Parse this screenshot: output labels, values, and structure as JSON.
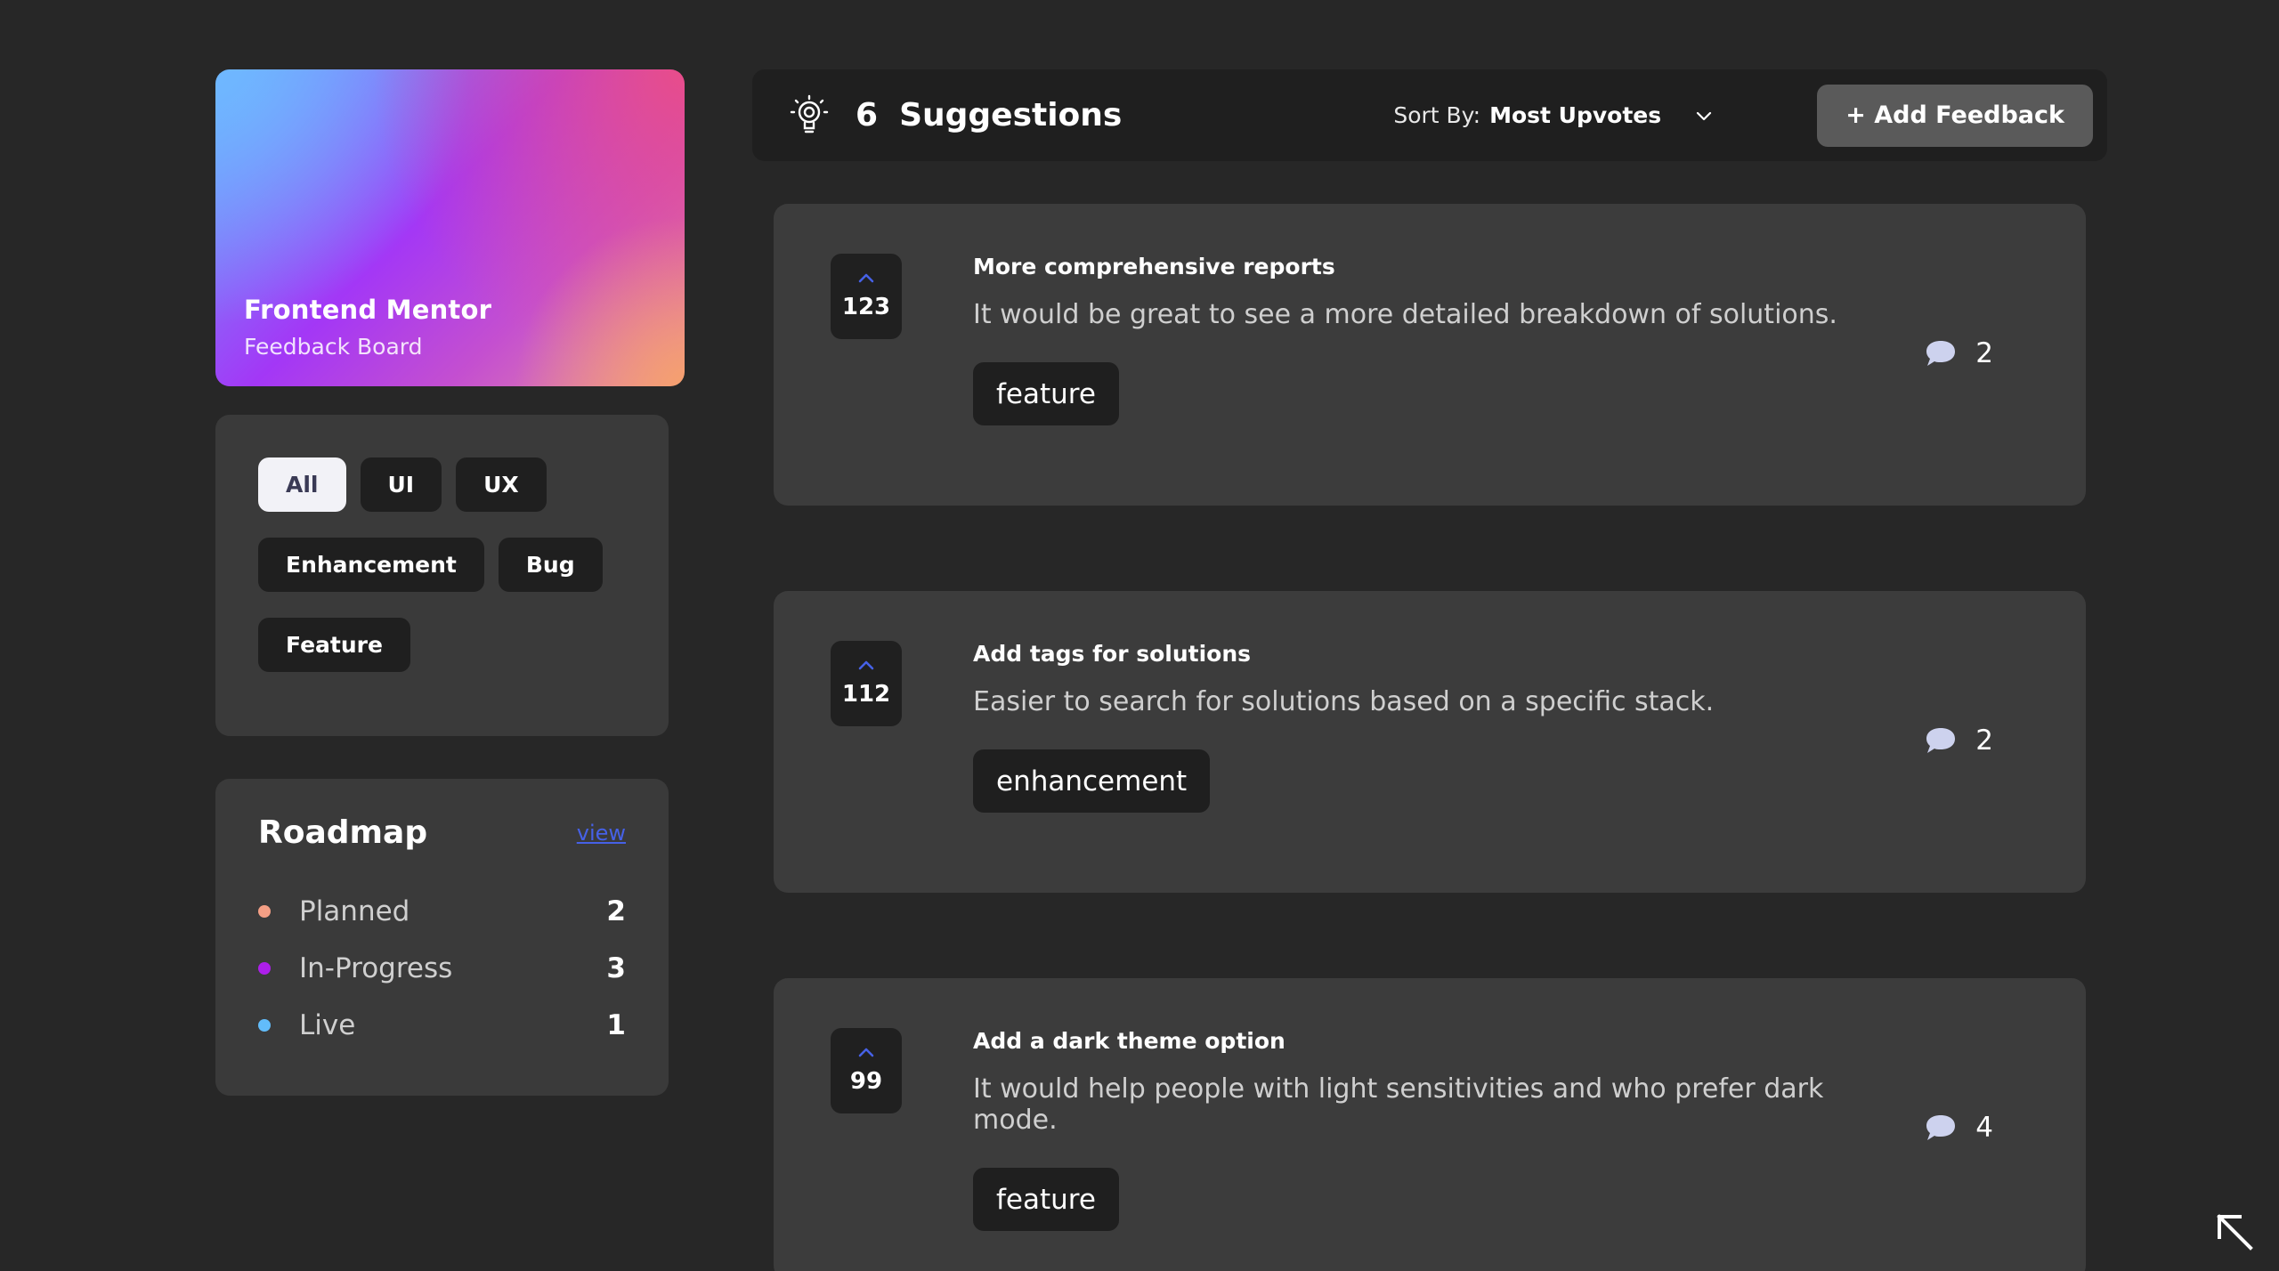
{
  "brand": {
    "title": "Frontend Mentor",
    "subtitle": "Feedback Board"
  },
  "filters": {
    "rows": [
      [
        {
          "label": "All",
          "active": true
        },
        {
          "label": "UI"
        },
        {
          "label": "UX"
        }
      ],
      [
        {
          "label": "Enhancement"
        },
        {
          "label": "Bug"
        }
      ],
      [
        {
          "label": "Feature"
        }
      ]
    ]
  },
  "roadmap": {
    "title": "Roadmap",
    "view_label": "view",
    "items": [
      {
        "name": "Planned",
        "count": "2",
        "color": "#f49f85"
      },
      {
        "name": "In-Progress",
        "count": "3",
        "color": "#ad1fea"
      },
      {
        "name": "Live",
        "count": "1",
        "color": "#62bcfa"
      }
    ]
  },
  "toolbar": {
    "count": "6",
    "label": "Suggestions",
    "sort_label": "Sort By:",
    "sort_value": "Most Upvotes",
    "add_label": "+ Add Feedback"
  },
  "suggestions": [
    {
      "votes": "123",
      "title": "More comprehensive reports",
      "description": "It would be great to see a more detailed breakdown of solutions.",
      "tag": "feature",
      "comments": "2"
    },
    {
      "votes": "112",
      "title": "Add tags for solutions",
      "description": "Easier to search for solutions based on a specific stack.",
      "tag": "enhancement",
      "comments": "2"
    },
    {
      "votes": "99",
      "title": "Add a dark theme option",
      "description": "It would help people with light sensitivities and who prefer dark mode.",
      "tag": "feature",
      "comments": "4"
    }
  ],
  "colors": {
    "accent": "#4661e6",
    "bg": "#272727",
    "card": "#3c3c3c"
  }
}
